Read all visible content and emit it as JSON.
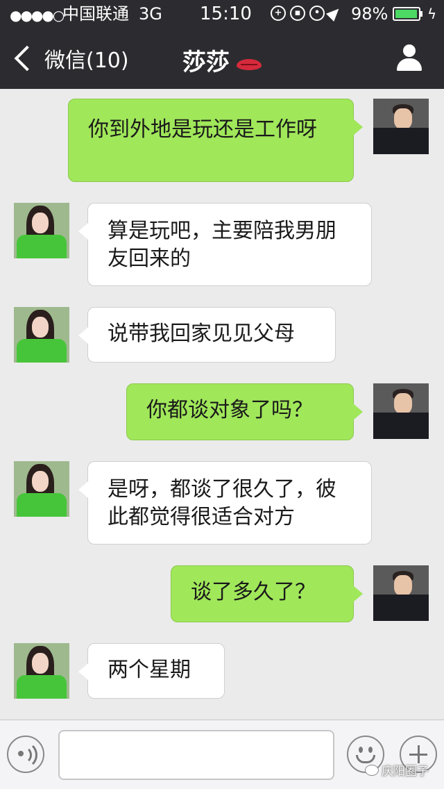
{
  "status_bar": {
    "signal": "●●●●○",
    "carrier": "中国联通",
    "network": "3G",
    "time": "15:10",
    "battery_percent": "98%",
    "battery_level": 0.98
  },
  "nav": {
    "back_label": "微信(10)",
    "title": "莎莎"
  },
  "messages": [
    {
      "from": "self",
      "text": "你到外地是玩还是工作呀"
    },
    {
      "from": "other",
      "line1": "算是玩吧，主要陪我男朋",
      "line2": "友回来的"
    },
    {
      "from": "other",
      "text": "说带我回家见见父母"
    },
    {
      "from": "self",
      "text": "你都谈对象了吗？"
    },
    {
      "from": "other",
      "line1": "是呀，都谈了很久了，彼",
      "line2": "此都觉得很适合对方"
    },
    {
      "from": "self",
      "text": "谈了多久了？"
    },
    {
      "from": "other",
      "text": "两个星期"
    }
  ],
  "input": {
    "value": ""
  },
  "watermark": "庆阳圈子",
  "colors": {
    "topbar": "#2c2c30",
    "self_bubble": "#a0e75a",
    "other_bubble": "#ffffff",
    "background": "#ebebeb"
  }
}
